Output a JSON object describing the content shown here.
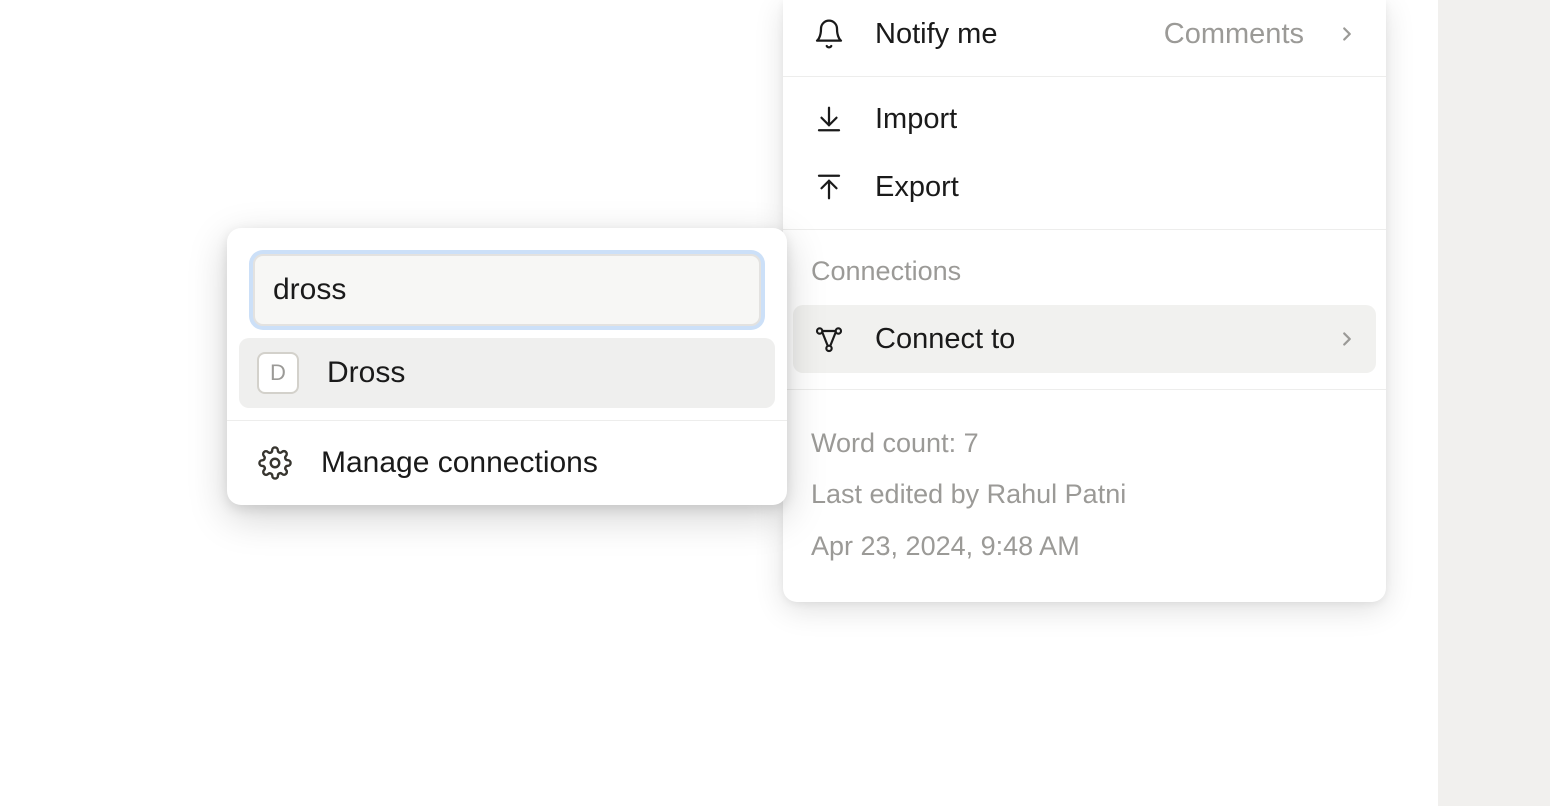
{
  "menu": {
    "notify": {
      "label": "Notify me",
      "value": "Comments"
    },
    "import": {
      "label": "Import"
    },
    "export": {
      "label": "Export"
    },
    "connections_header": "Connections",
    "connect": {
      "label": "Connect to"
    }
  },
  "footer": {
    "word_count_label": "Word count: ",
    "word_count_value": "7",
    "last_edited_prefix": "Last edited by ",
    "last_edited_by": "Rahul Patni",
    "timestamp": "Apr 23, 2024, 9:48 AM"
  },
  "search": {
    "input_value": "dross",
    "result": {
      "badge": "D",
      "label": "Dross"
    },
    "manage_label": "Manage connections"
  }
}
